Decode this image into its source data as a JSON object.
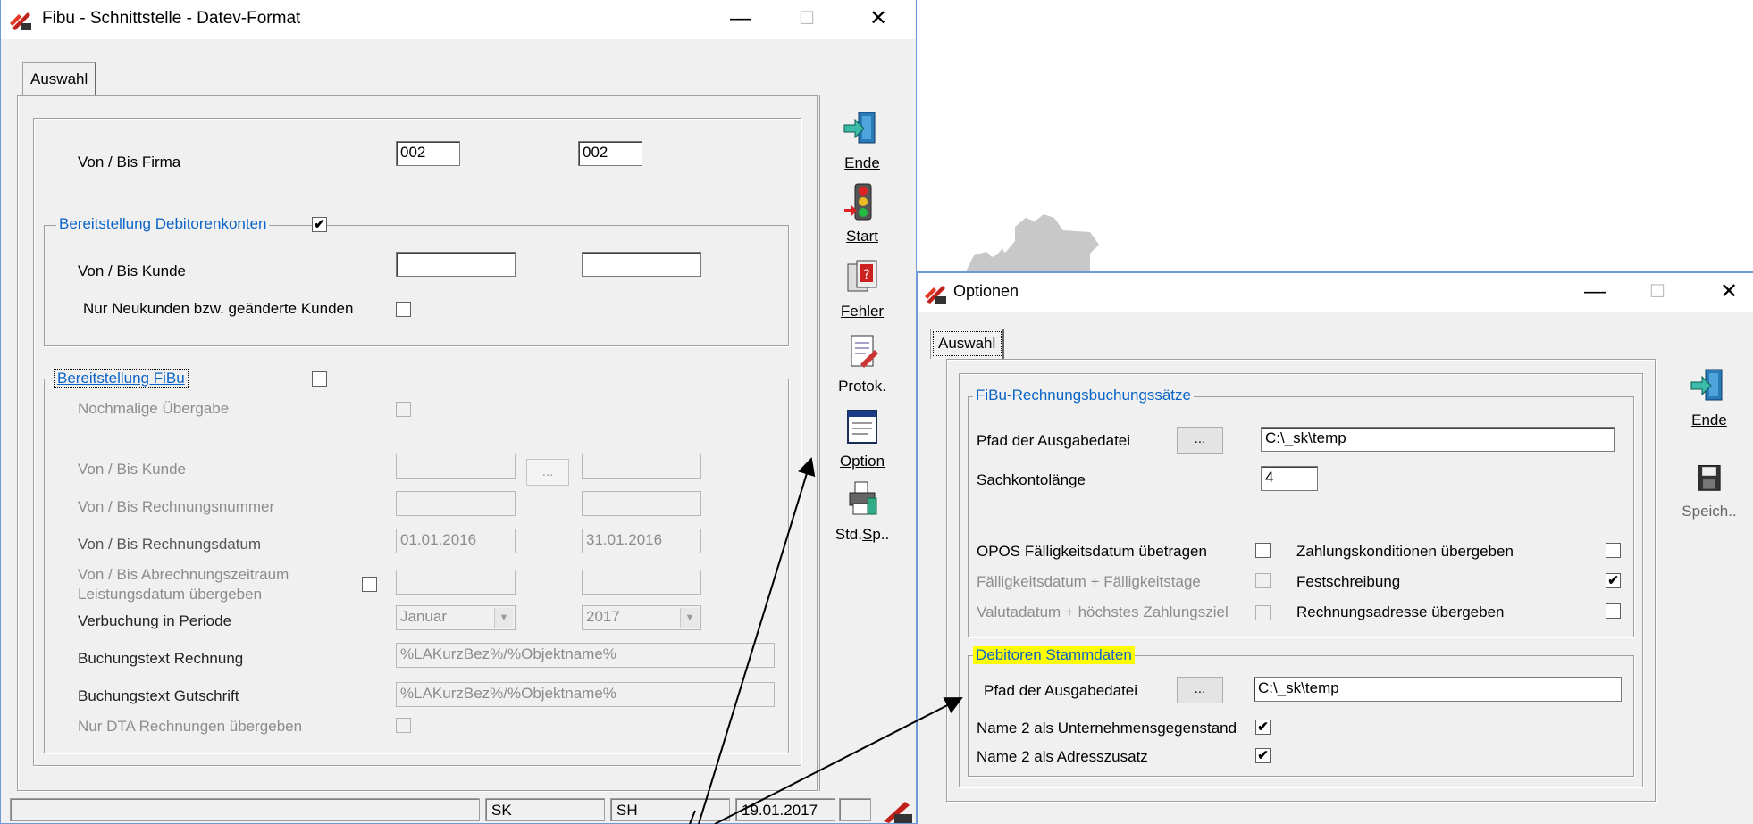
{
  "left_window": {
    "title": "Fibu - Schnittstelle - Datev-Format",
    "tab": "Auswahl",
    "firma": {
      "label": "Von / Bis Firma",
      "from": "002",
      "to": "002"
    },
    "debitoren_group": {
      "legend": "Bereitstellung Debitorenkonten",
      "checked": "✔",
      "kunde_label": "Von / Bis Kunde",
      "kunde_from": "",
      "kunde_to": "",
      "neukunden_label": "Nur Neukunden bzw. geänderte Kunden"
    },
    "fibu_group": {
      "legend": "Bereitstellung FiBu",
      "nochmalige_label": "Nochmalige Übergabe",
      "kunde_label": "Von / Bis Kunde",
      "kunde_button": "...",
      "rechnungsnummer_label": "Von / Bis Rechnungsnummer",
      "rechnungsdatum_label": "Von / Bis Rechnungsdatum",
      "rechnungsdatum_from": "01.01.2016",
      "rechnungsdatum_to": "31.01.2016",
      "abrechnung_label_1": "Von / Bis Abrechnungszeitraum",
      "abrechnung_label_2": "Leistungsdatum übergeben",
      "periode_label": "Verbuchung in Periode",
      "periode_month": "Januar",
      "periode_year": "2017",
      "text_rechnung_label": "Buchungstext Rechnung",
      "text_rechnung_value": "%LAKurzBez%/%Objektname%",
      "text_gutschrift_label": "Buchungstext Gutschrift",
      "text_gutschrift_value": "%LAKurzBez%/%Objektname%",
      "nur_dta_label": "Nur DTA Rechnungen übergeben"
    },
    "toolbar": {
      "ende": "Ende",
      "start": "Start",
      "fehler": "Fehler",
      "protok": "Protok.",
      "option": "Option",
      "stdsp": "Std.Sp.."
    },
    "status": {
      "cell1": "SK",
      "cell2": "SH",
      "date": "19.01.2017"
    }
  },
  "right_window": {
    "title": "Optionen",
    "tab": "Auswahl",
    "fibu_group": {
      "legend": "FiBu-Rechnungsbuchungssätze",
      "pfad_label": "Pfad der Ausgabedatei",
      "pfad_button": "...",
      "pfad_value": "C:\\_sk\\temp",
      "sachkonto_label": "Sachkontolänge",
      "sachkonto_value": "4",
      "opos_label": "OPOS Fälligkeitsdatum übetragen",
      "faellig_label": "Fälligkeitsdatum + Fälligkeitstage",
      "valuta_label": "Valutadatum + höchstes Zahlungsziel",
      "zahlung_label": "Zahlungskonditionen übergeben",
      "fest_label": "Festschreibung",
      "fest_checked": "✔",
      "adresse_label": "Rechnungsadresse übergeben"
    },
    "debitoren_group": {
      "legend": "Debitoren Stammdaten",
      "pfad_label": "Pfad der Ausgabedatei",
      "pfad_button": "...",
      "pfad_value": "C:\\_sk\\temp",
      "name2_gegenstand_label": "Name 2 als Unternehmensgegenstand",
      "name2_gegenstand_checked": "✔",
      "name2_adress_label": "Name 2 als Adresszusatz",
      "name2_adress_checked": "✔"
    },
    "toolbar": {
      "ende": "Ende",
      "speich": "Speich.."
    }
  },
  "colors": {
    "legend_blue": "#0a64c8",
    "highlight": "#ffff00",
    "window_bg": "#f0f0f0"
  }
}
